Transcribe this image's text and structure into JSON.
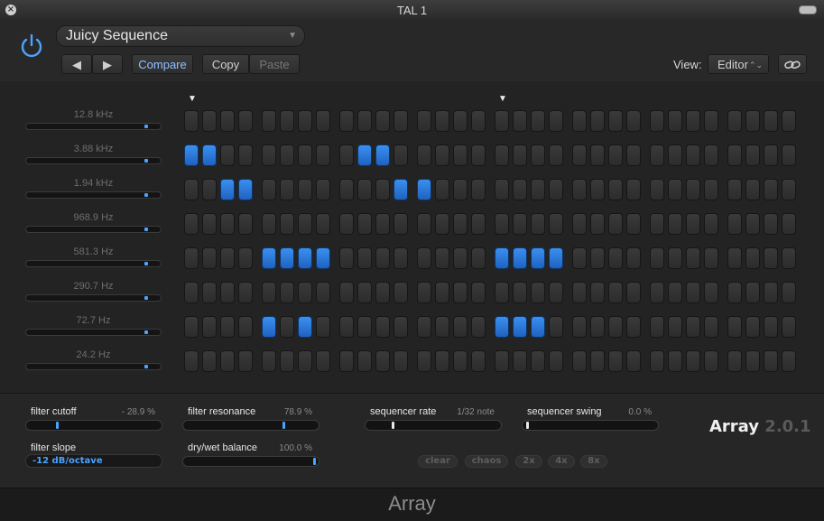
{
  "window": {
    "title": "TAL 1",
    "close_glyph": "×"
  },
  "header": {
    "preset_name": "Juicy Sequence",
    "prev_glyph": "◀",
    "next_glyph": "▶",
    "compare_label": "Compare",
    "copy_label": "Copy",
    "paste_label": "Paste",
    "view_label": "View:",
    "view_value": "Editor",
    "view_caret": "⌃⌄",
    "preset_caret": "▼",
    "accent_color": "#4aa3ff",
    "icons": {
      "power": "power-icon",
      "link": "link-icon"
    }
  },
  "filters": [
    {
      "label": "12.8 kHz",
      "level": 0.93
    },
    {
      "label": "3.88 kHz",
      "level": 0.93
    },
    {
      "label": "1.94 kHz",
      "level": 0.93
    },
    {
      "label": "968.9 Hz",
      "level": 0.93
    },
    {
      "label": "581.3 Hz",
      "level": 0.93
    },
    {
      "label": "290.7 Hz",
      "level": 0.93
    },
    {
      "label": "72.7 Hz",
      "level": 0.93
    },
    {
      "label": "24.2 Hz",
      "level": 0.93
    }
  ],
  "sequencer": {
    "steps": 32,
    "playhead_glyph": "▼",
    "playhead_steps": [
      1,
      17
    ],
    "active": [
      [],
      [
        1,
        2,
        10,
        11
      ],
      [
        3,
        4,
        12,
        13
      ],
      [],
      [
        5,
        6,
        7,
        8,
        17,
        18,
        19,
        20
      ],
      [],
      [
        5,
        7,
        17,
        18,
        19
      ],
      []
    ]
  },
  "controls": {
    "filter_cutoff": {
      "label": "filter cutoff",
      "value": "- 28.9 %",
      "level": 0.21
    },
    "filter_resonance": {
      "label": "filter resonance",
      "value": "78.9 %",
      "level": 0.76
    },
    "sequencer_rate": {
      "label": "sequencer rate",
      "value": "1/32 note",
      "level": 0.18
    },
    "sequencer_swing": {
      "label": "sequencer swing",
      "value": "0.0 %",
      "level": 0.0
    },
    "filter_slope": {
      "label": "filter slope",
      "value": "-12 dB/octave"
    },
    "dry_wet": {
      "label": "dry/wet balance",
      "value": "100.0 %",
      "level": 1.0
    }
  },
  "buttons": {
    "clear": "clear",
    "chaos": "chaos",
    "x2": "2x",
    "x4": "4x",
    "x8": "8x"
  },
  "brand": {
    "name": "Array",
    "version": "2.0.1"
  },
  "footer": {
    "title": "Array"
  }
}
